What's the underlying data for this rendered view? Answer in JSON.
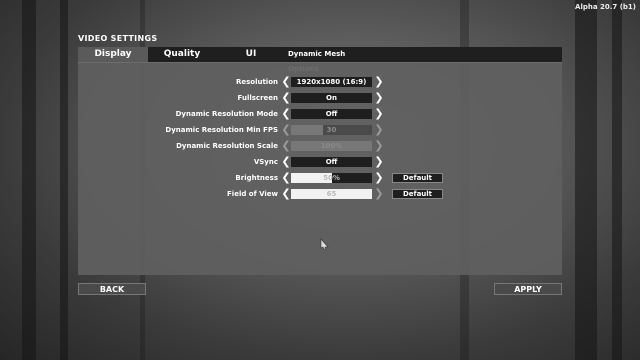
{
  "version": "Alpha 20.7 (b1)",
  "panel_title": "VIDEO SETTINGS",
  "tabs": [
    {
      "label": "Display",
      "active": true
    },
    {
      "label": "Quality"
    },
    {
      "label": "UI"
    },
    {
      "label": "Dynamic Mesh Options"
    }
  ],
  "rows": [
    {
      "label": "Resolution",
      "value": "1920x1080 (16:9)"
    },
    {
      "label": "Fullscreen",
      "value": "On"
    },
    {
      "label": "Dynamic Resolution Mode",
      "value": "Off"
    },
    {
      "label": "Dynamic Resolution Min FPS",
      "value": "30",
      "slider_fraction": 0.4,
      "disabled": true
    },
    {
      "label": "Dynamic Resolution Scale",
      "value": "100%",
      "slider_fraction": 1.0,
      "disabled": true
    },
    {
      "label": "VSync",
      "value": "Off"
    },
    {
      "label": "Brightness",
      "value": "50%",
      "slider_fraction": 0.5,
      "default_label": "Default"
    },
    {
      "label": "Field of View",
      "value": "65",
      "slider_fraction": 1.0,
      "default_label": "Default"
    }
  ],
  "buttons": {
    "back": "BACK",
    "apply": "APPLY"
  },
  "colors": {
    "panel": "#5f5f5f",
    "field": "#1e1e1e",
    "fill": "#f2f2f2",
    "tabbar": "#1f1f1f"
  }
}
